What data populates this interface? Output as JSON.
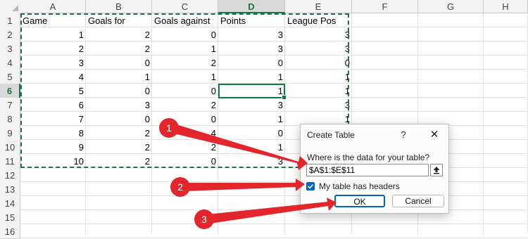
{
  "spreadsheet": {
    "columns": [
      "A",
      "B",
      "C",
      "D",
      "E",
      "F",
      "G",
      "H"
    ],
    "rows": [
      "1",
      "2",
      "3",
      "4",
      "5",
      "6",
      "7",
      "8",
      "9",
      "10",
      "11",
      "12",
      "13",
      "14",
      "15",
      "16"
    ],
    "headers": [
      "Game",
      "Goals for",
      "Goals against",
      "Points",
      "League Pos"
    ],
    "data": [
      [
        "1",
        "2",
        "0",
        "3",
        "3"
      ],
      [
        "2",
        "2",
        "1",
        "3",
        "3"
      ],
      [
        "3",
        "0",
        "2",
        "0",
        "0"
      ],
      [
        "4",
        "1",
        "1",
        "1",
        "1"
      ],
      [
        "5",
        "0",
        "0",
        "1",
        "1"
      ],
      [
        "6",
        "3",
        "2",
        "3",
        "3"
      ],
      [
        "7",
        "0",
        "0",
        "1",
        "1"
      ],
      [
        "8",
        "2",
        "4",
        "0",
        "0"
      ],
      [
        "9",
        "2",
        "2",
        "1",
        "1"
      ],
      [
        "10",
        "2",
        "0",
        "3",
        "3"
      ]
    ],
    "selected_column": "D",
    "selected_row": "6"
  },
  "dialog": {
    "title": "Create Table",
    "help_label": "?",
    "close_label": "✕",
    "prompt": "Where is the data for your table?",
    "range_value": "$A$1:$E$11",
    "has_headers_label": "My table has headers",
    "has_headers_checked": true,
    "ok_label": "OK",
    "cancel_label": "Cancel"
  },
  "annotations": {
    "color": "#e3262b",
    "badges": [
      "1",
      "2",
      "3"
    ]
  }
}
